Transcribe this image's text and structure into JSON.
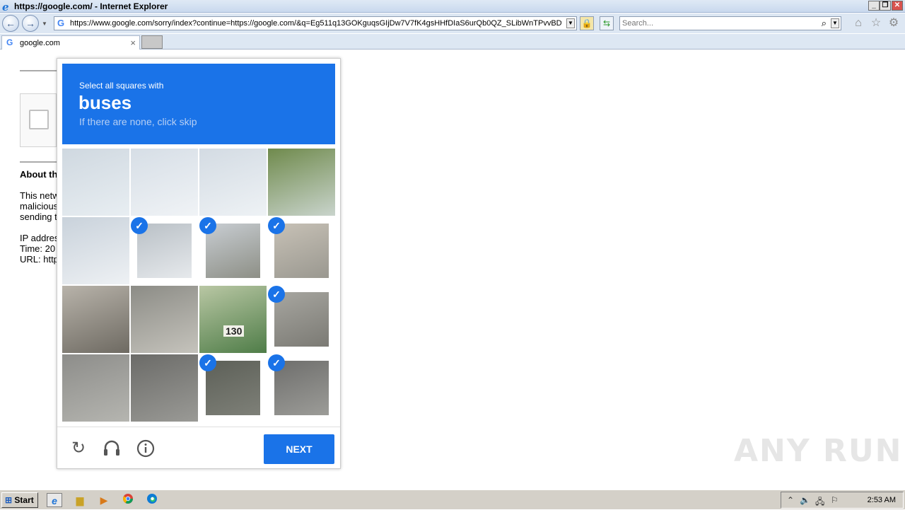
{
  "window": {
    "title": "https://google.com/ - Internet Explorer"
  },
  "nav": {
    "url": "https://www.google.com/sorry/index?continue=https://google.com/&q=Eg511q13GOKguqsGIjDw7V7fK4gsHHfDIaS6urQb0QZ_SLibWnTPvvBDwb",
    "search_placeholder": "Search..."
  },
  "tab": {
    "label": "google.com"
  },
  "page": {
    "about_heading": "About th",
    "text_lines": [
      "This netw",
      "malicious",
      "sending t"
    ],
    "info_lines": [
      "IP addres",
      "Time: 20",
      "URL: http"
    ]
  },
  "captcha": {
    "instruction": "Select all squares with",
    "target": "buses",
    "hint": "If there are none, click skip",
    "next_label": "NEXT",
    "tiles": [
      {
        "row": 0,
        "col": 0,
        "selected": false
      },
      {
        "row": 0,
        "col": 1,
        "selected": false
      },
      {
        "row": 0,
        "col": 2,
        "selected": false
      },
      {
        "row": 0,
        "col": 3,
        "selected": false
      },
      {
        "row": 1,
        "col": 0,
        "selected": false
      },
      {
        "row": 1,
        "col": 1,
        "selected": true
      },
      {
        "row": 1,
        "col": 2,
        "selected": true
      },
      {
        "row": 1,
        "col": 3,
        "selected": true
      },
      {
        "row": 2,
        "col": 0,
        "selected": false
      },
      {
        "row": 2,
        "col": 1,
        "selected": false
      },
      {
        "row": 2,
        "col": 2,
        "selected": false
      },
      {
        "row": 2,
        "col": 3,
        "selected": true
      },
      {
        "row": 3,
        "col": 0,
        "selected": false
      },
      {
        "row": 3,
        "col": 1,
        "selected": false
      },
      {
        "row": 3,
        "col": 2,
        "selected": true
      },
      {
        "row": 3,
        "col": 3,
        "selected": true
      }
    ],
    "bus_number": "130",
    "icons": [
      "reload-icon",
      "audio-icon",
      "info-icon"
    ]
  },
  "watermark": "ANY RUN",
  "taskbar": {
    "start_label": "Start",
    "clock": "2:53 AM"
  }
}
